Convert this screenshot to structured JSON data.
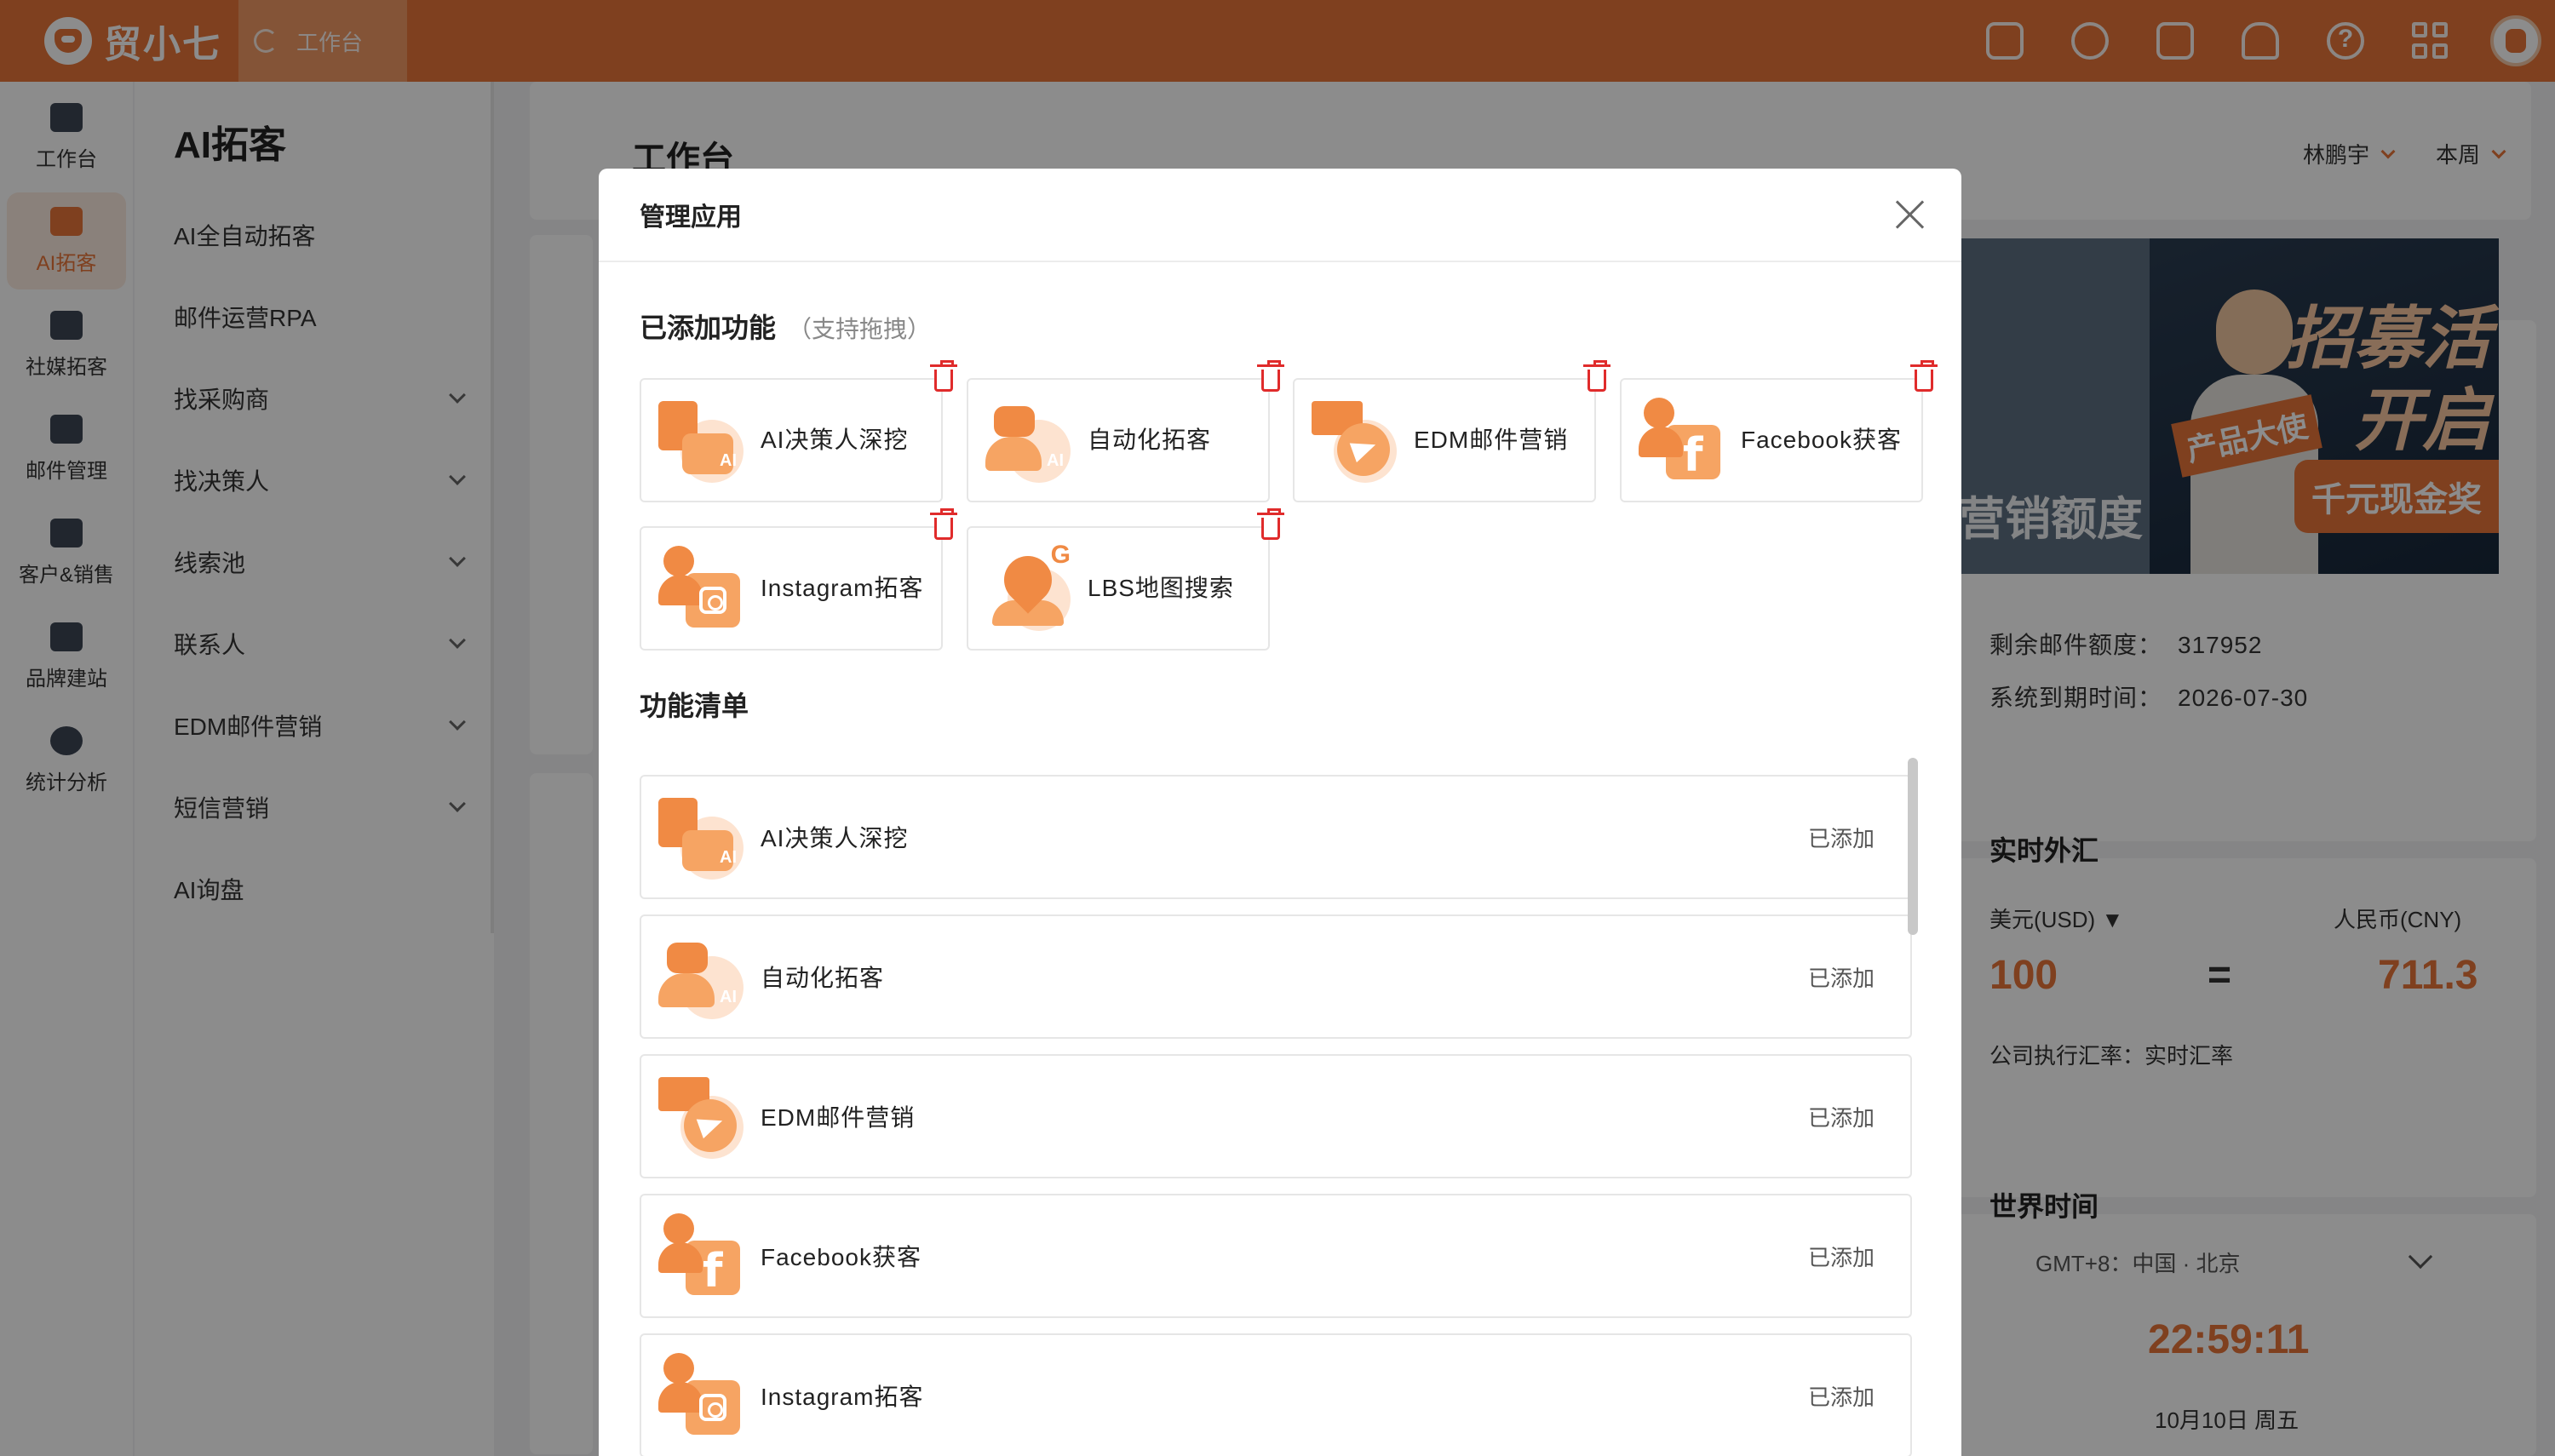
{
  "app": {
    "name": "贸小七"
  },
  "top_tab": {
    "label": "工作台"
  },
  "top_icons": [
    "document-check-icon",
    "whatsapp-icon",
    "share-icon",
    "bell-icon",
    "help-icon",
    "grid-icon"
  ],
  "leftnav": [
    {
      "label": "工作台",
      "icon": "monitor-icon"
    },
    {
      "label": "AI拓客",
      "icon": "robot-icon",
      "active": true
    },
    {
      "label": "社媒拓客",
      "icon": "people-icon"
    },
    {
      "label": "邮件管理",
      "icon": "mail-icon"
    },
    {
      "label": "客户&销售",
      "icon": "user-tie-icon"
    },
    {
      "label": "品牌建站",
      "icon": "chart-icon"
    },
    {
      "label": "统计分析",
      "icon": "pie-icon"
    }
  ],
  "submenu": {
    "title": "AI拓客",
    "items": [
      {
        "label": "AI全自动拓客",
        "has_children": false
      },
      {
        "label": "邮件运营RPA",
        "has_children": false
      },
      {
        "label": "找采购商",
        "has_children": true
      },
      {
        "label": "找决策人",
        "has_children": true
      },
      {
        "label": "线索池",
        "has_children": true
      },
      {
        "label": "联系人",
        "has_children": true
      },
      {
        "label": "EDM邮件营销",
        "has_children": true
      },
      {
        "label": "短信营销",
        "has_children": true
      },
      {
        "label": "AI询盘",
        "has_children": false
      }
    ]
  },
  "workspace": {
    "title": "工作台",
    "filter_user": "林鹏宇",
    "filter_period": "本周"
  },
  "banner": {
    "left_text": "营销额度",
    "title_line1": "招募活",
    "title_line2": "开启",
    "tag": "产品大使",
    "reward": "千元现金奖"
  },
  "email_info": {
    "quota_label": "剩余邮件额度：",
    "quota_value": "317952",
    "expire_label": "系统到期时间：",
    "expire_value": "2026-07-30"
  },
  "fx": {
    "title": "实时外汇",
    "from_currency": "美元(USD)",
    "to_currency": "人民币(CNY)",
    "from_value": "100",
    "equals": "=",
    "to_value": "711.3",
    "rate_note": "公司执行汇率：实时汇率"
  },
  "world_time": {
    "title": "世界时间",
    "zone": "GMT+8：中国 · 北京",
    "time": "22:59:11",
    "date": "10月10日 周五"
  },
  "modal": {
    "title": "管理应用",
    "added_title": "已添加功能",
    "added_hint": "（支持拖拽）",
    "added": [
      {
        "label": "AI决策人深挖",
        "icon": "ai-decision-icon"
      },
      {
        "label": "自动化拓客",
        "icon": "ai-robot-icon"
      },
      {
        "label": "EDM邮件营销",
        "icon": "edm-mail-icon"
      },
      {
        "label": "Facebook获客",
        "icon": "facebook-icon"
      },
      {
        "label": "Instagram拓客",
        "icon": "instagram-icon"
      },
      {
        "label": "LBS地图搜索",
        "icon": "map-pin-icon"
      }
    ],
    "list_title": "功能清单",
    "list": [
      {
        "label": "AI决策人深挖",
        "status": "已添加",
        "icon": "ai-decision-icon"
      },
      {
        "label": "自动化拓客",
        "status": "已添加",
        "icon": "ai-robot-icon"
      },
      {
        "label": "EDM邮件营销",
        "status": "已添加",
        "icon": "edm-mail-icon"
      },
      {
        "label": "Facebook获客",
        "status": "已添加",
        "icon": "facebook-icon"
      },
      {
        "label": "Instagram拓客",
        "status": "已添加",
        "icon": "instagram-icon"
      }
    ]
  },
  "colors": {
    "brand": "#e8763a",
    "danger": "#e02b2b",
    "overlay": "rgba(0,0,0,0.45)"
  }
}
